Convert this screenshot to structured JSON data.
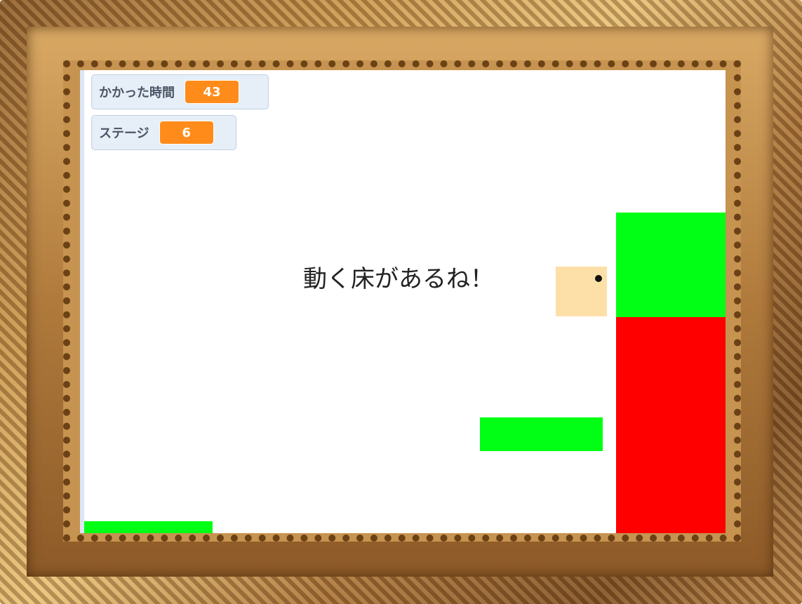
{
  "monitors": {
    "time": {
      "label": "かかった時間",
      "value": "43"
    },
    "stage": {
      "label": "ステージ",
      "value": "6"
    }
  },
  "speech": {
    "text": "動く床があるね！"
  },
  "colors": {
    "platform": "#00ff14",
    "danger": "#ff0000",
    "player": "#fde0a8",
    "monitor_value": "#ff8c1a",
    "frame_gold": "#c9964f"
  }
}
